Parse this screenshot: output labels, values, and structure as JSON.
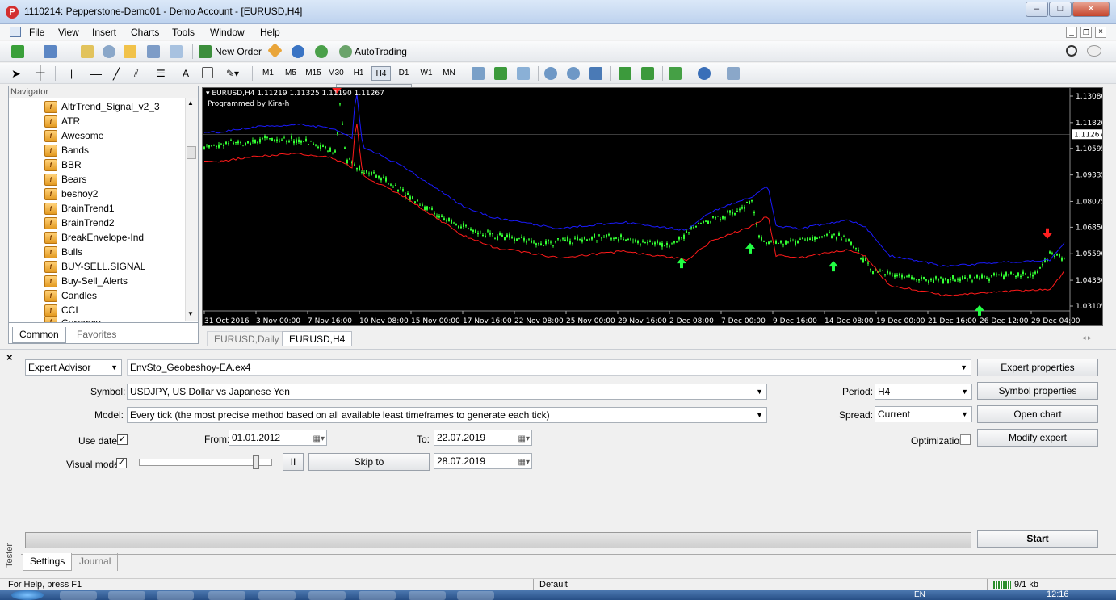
{
  "window": {
    "title": "1110214: Pepperstone-Demo01 - Demo Account - [EURUSD,H4]",
    "logo_letter": "P",
    "minimize": "–",
    "maximize": "□",
    "close": "✕"
  },
  "menu": [
    "File",
    "View",
    "Insert",
    "Charts",
    "Tools",
    "Window",
    "Help"
  ],
  "toolbar": {
    "new_order": "New Order",
    "autotrading": "AutoTrading",
    "text_tool": "A",
    "timeframes": [
      "M1",
      "M5",
      "M15",
      "M30",
      "H1",
      "H4",
      "D1",
      "W1",
      "MN"
    ],
    "active_timeframe": "H4"
  },
  "navigator": {
    "title": "Navigator",
    "items": [
      "AltrTrend_Signal_v2_3",
      "ATR",
      "Awesome",
      "Bands",
      "BBR",
      "Bears",
      "beshoy2",
      "BrainTrend1",
      "BrainTrend2",
      "BreakEnvelope-Ind",
      "Bulls",
      "BUY-SELL.SIGNAL",
      "Buy-Sell_Alerts",
      "Candles",
      "CCI",
      "Currency"
    ],
    "tabs": [
      "Common",
      "Favorites"
    ]
  },
  "chart": {
    "header": "EURUSD,H4  1.11219 1.11325 1.11190 1.11267",
    "subheader": "Programmed by Kira-h",
    "current_price": "1.11267",
    "price_labels": [
      "1.13080",
      "1.11820",
      "1.10595",
      "1.09335",
      "1.08075",
      "1.06850",
      "1.05590",
      "1.04330",
      "1.03105"
    ],
    "time_labels": [
      "31 Oct 2016",
      "3 Nov 00:00",
      "7 Nov 16:00",
      "10 Nov 08:00",
      "15 Nov 00:00",
      "17 Nov 16:00",
      "22 Nov 08:00",
      "25 Nov 00:00",
      "29 Nov 16:00",
      "2 Dec 08:00",
      "7 Dec 00:00",
      "9 Dec 16:00",
      "14 Dec 08:00",
      "19 Dec 00:00",
      "21 Dec 16:00",
      "26 Dec 12:00",
      "29 Dec 04:00"
    ],
    "tabs": [
      "EURUSD,Daily",
      "EURUSD,H4"
    ],
    "active_tab": "EURUSD,H4",
    "colors": {
      "background": "#000000",
      "candles": "#33ff33",
      "upper_band": "#1a1aff",
      "lower_band": "#ff1a1a",
      "buy_arrow": "#22ff44",
      "sell_arrow": "#ff2020"
    }
  },
  "tester": {
    "side_label": "Tester",
    "close_x": "×",
    "type": "Expert Advisor",
    "expert": "EnvSto_Geobeshoy-EA.ex4",
    "symbol_label": "Symbol:",
    "symbol": "USDJPY, US Dollar vs Japanese Yen",
    "model_label": "Model:",
    "model": "Every tick (the most precise method based on all available least timeframes to generate each tick)",
    "use_date_label": "Use date",
    "use_date": true,
    "from_label": "From:",
    "from": "01.01.2012",
    "to_label": "To:",
    "to": "22.07.2019",
    "visual_mode_label": "Visual mode",
    "visual_mode": true,
    "visual_speed": 0.9,
    "pause": "II",
    "skip_to": "Skip to",
    "skip_date": "28.07.2019",
    "period_label": "Period:",
    "period": "H4",
    "spread_label": "Spread:",
    "spread": "Current",
    "optimization_label": "Optimization",
    "optimization": false,
    "buttons": {
      "expert_properties": "Expert properties",
      "symbol_properties": "Symbol properties",
      "open_chart": "Open chart",
      "modify_expert": "Modify expert",
      "start": "Start"
    },
    "progress": 0,
    "tabs": [
      "Settings",
      "Journal"
    ]
  },
  "status": {
    "help": "For Help, press F1",
    "profile": "Default",
    "traffic": "9/1 kb"
  },
  "taskbar": {
    "language": "EN",
    "time": "12:16"
  }
}
